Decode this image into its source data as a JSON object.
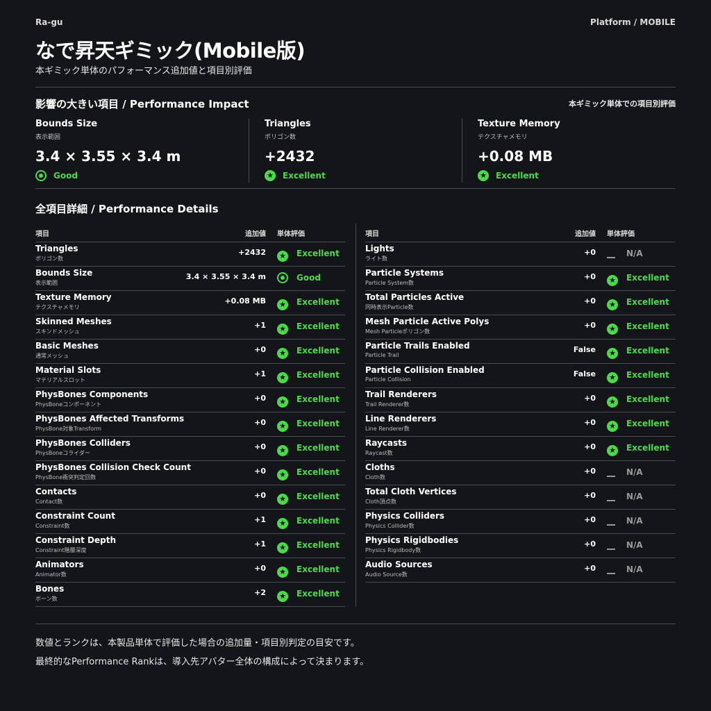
{
  "header": {
    "brand": "Ra-gu",
    "platform": "Platform / MOBILE",
    "title": "なで昇天ギミック(Mobile版)",
    "subtitle": "本ギミック単体のパフォーマンス追加値と項目別評価"
  },
  "impact": {
    "section_title": "影響の大きい項目 / Performance Impact",
    "note": "本ギミック単体での項目別評価",
    "cards": [
      {
        "label": "Bounds Size",
        "sub": "表示範囲",
        "value": "3.4 × 3.55 × 3.4 m",
        "rating": "Good",
        "icon": "good-icon"
      },
      {
        "label": "Triangles",
        "sub": "ポリゴン数",
        "value": "+2432",
        "rating": "Excellent",
        "icon": "excellent-star-icon"
      },
      {
        "label": "Texture Memory",
        "sub": "テクスチャメモリ",
        "value": "+0.08 MB",
        "rating": "Excellent",
        "icon": "excellent-star-icon"
      }
    ]
  },
  "details": {
    "section_title": "全項目詳細 / Performance Details",
    "col_item": "項目",
    "col_value": "追加値",
    "col_rating": "単体評価",
    "left": [
      {
        "name": "Triangles",
        "sub": "ポリゴン数",
        "value": "+2432",
        "rating": "Excellent",
        "icon": "excellent-star-icon"
      },
      {
        "name": "Bounds Size",
        "sub": "表示範囲",
        "value": "3.4 × 3.55 × 3.4 m",
        "rating": "Good",
        "icon": "good-icon"
      },
      {
        "name": "Texture Memory",
        "sub": "テクスチャメモリ",
        "value": "+0.08 MB",
        "rating": "Excellent",
        "icon": "excellent-star-icon"
      },
      {
        "name": "Skinned Meshes",
        "sub": "スキンドメッシュ",
        "value": "+1",
        "rating": "Excellent",
        "icon": "excellent-star-icon"
      },
      {
        "name": "Basic Meshes",
        "sub": "通常メッシュ",
        "value": "+0",
        "rating": "Excellent",
        "icon": "excellent-star-icon"
      },
      {
        "name": "Material Slots",
        "sub": "マテリアルスロット",
        "value": "+1",
        "rating": "Excellent",
        "icon": "excellent-star-icon"
      },
      {
        "name": "PhysBones Components",
        "sub": "PhysBoneコンポーネント",
        "value": "+0",
        "rating": "Excellent",
        "icon": "excellent-star-icon"
      },
      {
        "name": "PhysBones Affected Transforms",
        "sub": "PhysBone対象Transform",
        "value": "+0",
        "rating": "Excellent",
        "icon": "excellent-star-icon"
      },
      {
        "name": "PhysBones Colliders",
        "sub": "PhysBoneコライダー",
        "value": "+0",
        "rating": "Excellent",
        "icon": "excellent-star-icon"
      },
      {
        "name": "PhysBones Collision Check Count",
        "sub": "PhysBone衝突判定回数",
        "value": "+0",
        "rating": "Excellent",
        "icon": "excellent-star-icon"
      },
      {
        "name": "Contacts",
        "sub": "Contact数",
        "value": "+0",
        "rating": "Excellent",
        "icon": "excellent-star-icon"
      },
      {
        "name": "Constraint Count",
        "sub": "Constraint数",
        "value": "+1",
        "rating": "Excellent",
        "icon": "excellent-star-icon"
      },
      {
        "name": "Constraint Depth",
        "sub": "Constraint階層深度",
        "value": "+1",
        "rating": "Excellent",
        "icon": "excellent-star-icon"
      },
      {
        "name": "Animators",
        "sub": "Animator数",
        "value": "+0",
        "rating": "Excellent",
        "icon": "excellent-star-icon"
      },
      {
        "name": "Bones",
        "sub": "ボーン数",
        "value": "+2",
        "rating": "Excellent",
        "icon": "excellent-star-icon"
      }
    ],
    "right": [
      {
        "name": "Lights",
        "sub": "ライト数",
        "value": "+0",
        "rating": "N/A",
        "icon": "na-dash-icon"
      },
      {
        "name": "Particle Systems",
        "sub": "Particle System数",
        "value": "+0",
        "rating": "Excellent",
        "icon": "excellent-star-icon"
      },
      {
        "name": "Total Particles Active",
        "sub": "同時表示Particle数",
        "value": "+0",
        "rating": "Excellent",
        "icon": "excellent-star-icon"
      },
      {
        "name": "Mesh Particle Active Polys",
        "sub": "Mesh Particleポリゴン数",
        "value": "+0",
        "rating": "Excellent",
        "icon": "excellent-star-icon"
      },
      {
        "name": "Particle Trails Enabled",
        "sub": "Particle Trail",
        "value": "False",
        "rating": "Excellent",
        "icon": "excellent-star-icon"
      },
      {
        "name": "Particle Collision Enabled",
        "sub": "Particle Collision",
        "value": "False",
        "rating": "Excellent",
        "icon": "excellent-star-icon"
      },
      {
        "name": "Trail Renderers",
        "sub": "Trail Renderer数",
        "value": "+0",
        "rating": "Excellent",
        "icon": "excellent-star-icon"
      },
      {
        "name": "Line Renderers",
        "sub": "Line Renderer数",
        "value": "+0",
        "rating": "Excellent",
        "icon": "excellent-star-icon"
      },
      {
        "name": "Raycasts",
        "sub": "Raycast数",
        "value": "+0",
        "rating": "Excellent",
        "icon": "excellent-star-icon"
      },
      {
        "name": "Cloths",
        "sub": "Cloth数",
        "value": "+0",
        "rating": "N/A",
        "icon": "na-dash-icon"
      },
      {
        "name": "Total Cloth Vertices",
        "sub": "Cloth頂点数",
        "value": "+0",
        "rating": "N/A",
        "icon": "na-dash-icon"
      },
      {
        "name": "Physics Colliders",
        "sub": "Physics Collider数",
        "value": "+0",
        "rating": "N/A",
        "icon": "na-dash-icon"
      },
      {
        "name": "Physics Rigidbodies",
        "sub": "Physics Rigidbody数",
        "value": "+0",
        "rating": "N/A",
        "icon": "na-dash-icon"
      },
      {
        "name": "Audio Sources",
        "sub": "Audio Source数",
        "value": "+0",
        "rating": "N/A",
        "icon": "na-dash-icon"
      }
    ]
  },
  "footer": {
    "line1": "数値とランクは、本製品単体で評価した場合の追加量・項目別判定の目安です。",
    "line2": "最終的なPerformance Rankは、導入先アバター全体の構成によって決まります。"
  },
  "colors": {
    "accent": "#4cd94c",
    "background": "#141518",
    "divider": "#4a4b4f",
    "na": "#9a9a9a"
  }
}
